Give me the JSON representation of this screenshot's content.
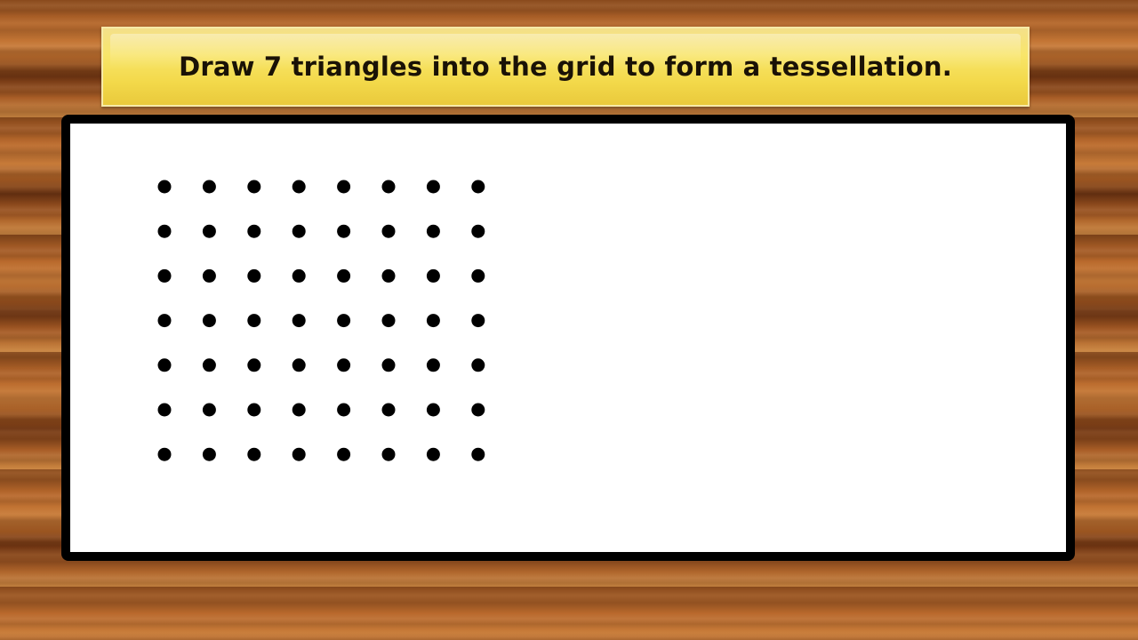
{
  "instruction": {
    "text": "Draw 7 triangles into the grid to form a tessellation."
  },
  "dot_grid": {
    "rows": 7,
    "columns": 8,
    "dot_color": "#000000"
  },
  "colors": {
    "banner_yellow": "#f8e56a",
    "board_border": "#000000",
    "board_background": "#ffffff",
    "wood_brown": "#b9692c"
  }
}
